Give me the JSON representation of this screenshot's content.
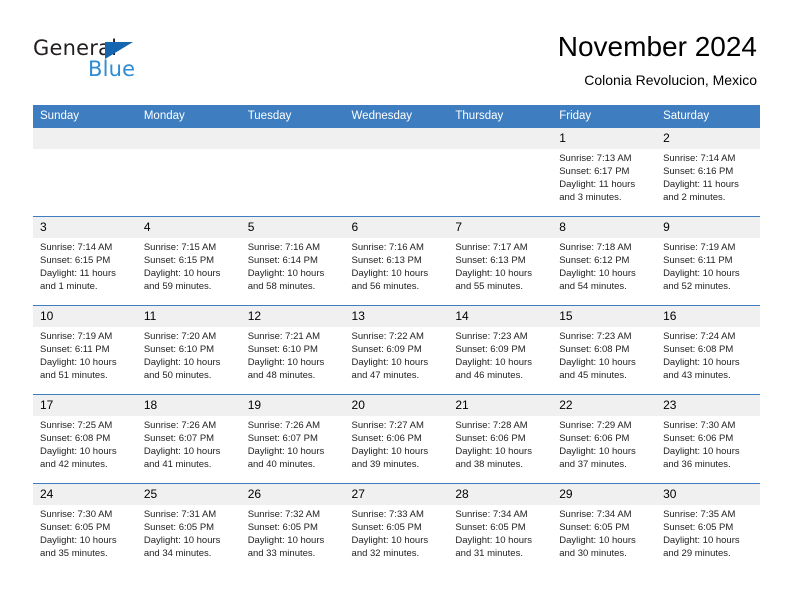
{
  "brand": {
    "name_part1": "General",
    "name_part2": "Blue",
    "triangle_color": "#1565b0",
    "blue_color": "#2e8bd4"
  },
  "header": {
    "title": "November 2024",
    "subtitle": "Colonia Revolucion, Mexico",
    "accent_color": "#3d7dc0",
    "daynum_background": "#f0f0f0"
  },
  "weekday_headers": [
    "Sunday",
    "Monday",
    "Tuesday",
    "Wednesday",
    "Thursday",
    "Friday",
    "Saturday"
  ],
  "weeks": [
    [
      {
        "day": "",
        "empty": true
      },
      {
        "day": "",
        "empty": true
      },
      {
        "day": "",
        "empty": true
      },
      {
        "day": "",
        "empty": true
      },
      {
        "day": "",
        "empty": true
      },
      {
        "day": "1",
        "sunrise": "Sunrise: 7:13 AM",
        "sunset": "Sunset: 6:17 PM",
        "daylight_line1": "Daylight: 11 hours",
        "daylight_line2": "and 3 minutes."
      },
      {
        "day": "2",
        "sunrise": "Sunrise: 7:14 AM",
        "sunset": "Sunset: 6:16 PM",
        "daylight_line1": "Daylight: 11 hours",
        "daylight_line2": "and 2 minutes."
      }
    ],
    [
      {
        "day": "3",
        "sunrise": "Sunrise: 7:14 AM",
        "sunset": "Sunset: 6:15 PM",
        "daylight_line1": "Daylight: 11 hours",
        "daylight_line2": "and 1 minute."
      },
      {
        "day": "4",
        "sunrise": "Sunrise: 7:15 AM",
        "sunset": "Sunset: 6:15 PM",
        "daylight_line1": "Daylight: 10 hours",
        "daylight_line2": "and 59 minutes."
      },
      {
        "day": "5",
        "sunrise": "Sunrise: 7:16 AM",
        "sunset": "Sunset: 6:14 PM",
        "daylight_line1": "Daylight: 10 hours",
        "daylight_line2": "and 58 minutes."
      },
      {
        "day": "6",
        "sunrise": "Sunrise: 7:16 AM",
        "sunset": "Sunset: 6:13 PM",
        "daylight_line1": "Daylight: 10 hours",
        "daylight_line2": "and 56 minutes."
      },
      {
        "day": "7",
        "sunrise": "Sunrise: 7:17 AM",
        "sunset": "Sunset: 6:13 PM",
        "daylight_line1": "Daylight: 10 hours",
        "daylight_line2": "and 55 minutes."
      },
      {
        "day": "8",
        "sunrise": "Sunrise: 7:18 AM",
        "sunset": "Sunset: 6:12 PM",
        "daylight_line1": "Daylight: 10 hours",
        "daylight_line2": "and 54 minutes."
      },
      {
        "day": "9",
        "sunrise": "Sunrise: 7:19 AM",
        "sunset": "Sunset: 6:11 PM",
        "daylight_line1": "Daylight: 10 hours",
        "daylight_line2": "and 52 minutes."
      }
    ],
    [
      {
        "day": "10",
        "sunrise": "Sunrise: 7:19 AM",
        "sunset": "Sunset: 6:11 PM",
        "daylight_line1": "Daylight: 10 hours",
        "daylight_line2": "and 51 minutes."
      },
      {
        "day": "11",
        "sunrise": "Sunrise: 7:20 AM",
        "sunset": "Sunset: 6:10 PM",
        "daylight_line1": "Daylight: 10 hours",
        "daylight_line2": "and 50 minutes."
      },
      {
        "day": "12",
        "sunrise": "Sunrise: 7:21 AM",
        "sunset": "Sunset: 6:10 PM",
        "daylight_line1": "Daylight: 10 hours",
        "daylight_line2": "and 48 minutes."
      },
      {
        "day": "13",
        "sunrise": "Sunrise: 7:22 AM",
        "sunset": "Sunset: 6:09 PM",
        "daylight_line1": "Daylight: 10 hours",
        "daylight_line2": "and 47 minutes."
      },
      {
        "day": "14",
        "sunrise": "Sunrise: 7:23 AM",
        "sunset": "Sunset: 6:09 PM",
        "daylight_line1": "Daylight: 10 hours",
        "daylight_line2": "and 46 minutes."
      },
      {
        "day": "15",
        "sunrise": "Sunrise: 7:23 AM",
        "sunset": "Sunset: 6:08 PM",
        "daylight_line1": "Daylight: 10 hours",
        "daylight_line2": "and 45 minutes."
      },
      {
        "day": "16",
        "sunrise": "Sunrise: 7:24 AM",
        "sunset": "Sunset: 6:08 PM",
        "daylight_line1": "Daylight: 10 hours",
        "daylight_line2": "and 43 minutes."
      }
    ],
    [
      {
        "day": "17",
        "sunrise": "Sunrise: 7:25 AM",
        "sunset": "Sunset: 6:08 PM",
        "daylight_line1": "Daylight: 10 hours",
        "daylight_line2": "and 42 minutes."
      },
      {
        "day": "18",
        "sunrise": "Sunrise: 7:26 AM",
        "sunset": "Sunset: 6:07 PM",
        "daylight_line1": "Daylight: 10 hours",
        "daylight_line2": "and 41 minutes."
      },
      {
        "day": "19",
        "sunrise": "Sunrise: 7:26 AM",
        "sunset": "Sunset: 6:07 PM",
        "daylight_line1": "Daylight: 10 hours",
        "daylight_line2": "and 40 minutes."
      },
      {
        "day": "20",
        "sunrise": "Sunrise: 7:27 AM",
        "sunset": "Sunset: 6:06 PM",
        "daylight_line1": "Daylight: 10 hours",
        "daylight_line2": "and 39 minutes."
      },
      {
        "day": "21",
        "sunrise": "Sunrise: 7:28 AM",
        "sunset": "Sunset: 6:06 PM",
        "daylight_line1": "Daylight: 10 hours",
        "daylight_line2": "and 38 minutes."
      },
      {
        "day": "22",
        "sunrise": "Sunrise: 7:29 AM",
        "sunset": "Sunset: 6:06 PM",
        "daylight_line1": "Daylight: 10 hours",
        "daylight_line2": "and 37 minutes."
      },
      {
        "day": "23",
        "sunrise": "Sunrise: 7:30 AM",
        "sunset": "Sunset: 6:06 PM",
        "daylight_line1": "Daylight: 10 hours",
        "daylight_line2": "and 36 minutes."
      }
    ],
    [
      {
        "day": "24",
        "sunrise": "Sunrise: 7:30 AM",
        "sunset": "Sunset: 6:05 PM",
        "daylight_line1": "Daylight: 10 hours",
        "daylight_line2": "and 35 minutes."
      },
      {
        "day": "25",
        "sunrise": "Sunrise: 7:31 AM",
        "sunset": "Sunset: 6:05 PM",
        "daylight_line1": "Daylight: 10 hours",
        "daylight_line2": "and 34 minutes."
      },
      {
        "day": "26",
        "sunrise": "Sunrise: 7:32 AM",
        "sunset": "Sunset: 6:05 PM",
        "daylight_line1": "Daylight: 10 hours",
        "daylight_line2": "and 33 minutes."
      },
      {
        "day": "27",
        "sunrise": "Sunrise: 7:33 AM",
        "sunset": "Sunset: 6:05 PM",
        "daylight_line1": "Daylight: 10 hours",
        "daylight_line2": "and 32 minutes."
      },
      {
        "day": "28",
        "sunrise": "Sunrise: 7:34 AM",
        "sunset": "Sunset: 6:05 PM",
        "daylight_line1": "Daylight: 10 hours",
        "daylight_line2": "and 31 minutes."
      },
      {
        "day": "29",
        "sunrise": "Sunrise: 7:34 AM",
        "sunset": "Sunset: 6:05 PM",
        "daylight_line1": "Daylight: 10 hours",
        "daylight_line2": "and 30 minutes."
      },
      {
        "day": "30",
        "sunrise": "Sunrise: 7:35 AM",
        "sunset": "Sunset: 6:05 PM",
        "daylight_line1": "Daylight: 10 hours",
        "daylight_line2": "and 29 minutes."
      }
    ]
  ]
}
